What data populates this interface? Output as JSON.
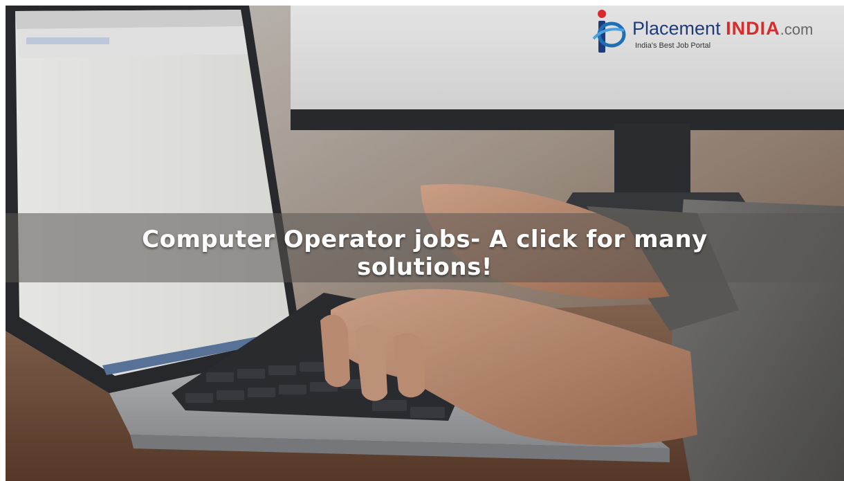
{
  "headline": {
    "line1": "Computer Operator jobs- A click for many",
    "line2": "solutions!"
  },
  "logo": {
    "name_part1": "Placement",
    "name_part2": "INDIA",
    "name_part3": ".com",
    "tagline": "India's Best Job Portal",
    "colors": {
      "primary": "#1f3c7a",
      "accent": "#d82b2b",
      "suffix": "#666666"
    }
  },
  "photo": {
    "subject": "hands typing on laptop with monitor in background"
  }
}
